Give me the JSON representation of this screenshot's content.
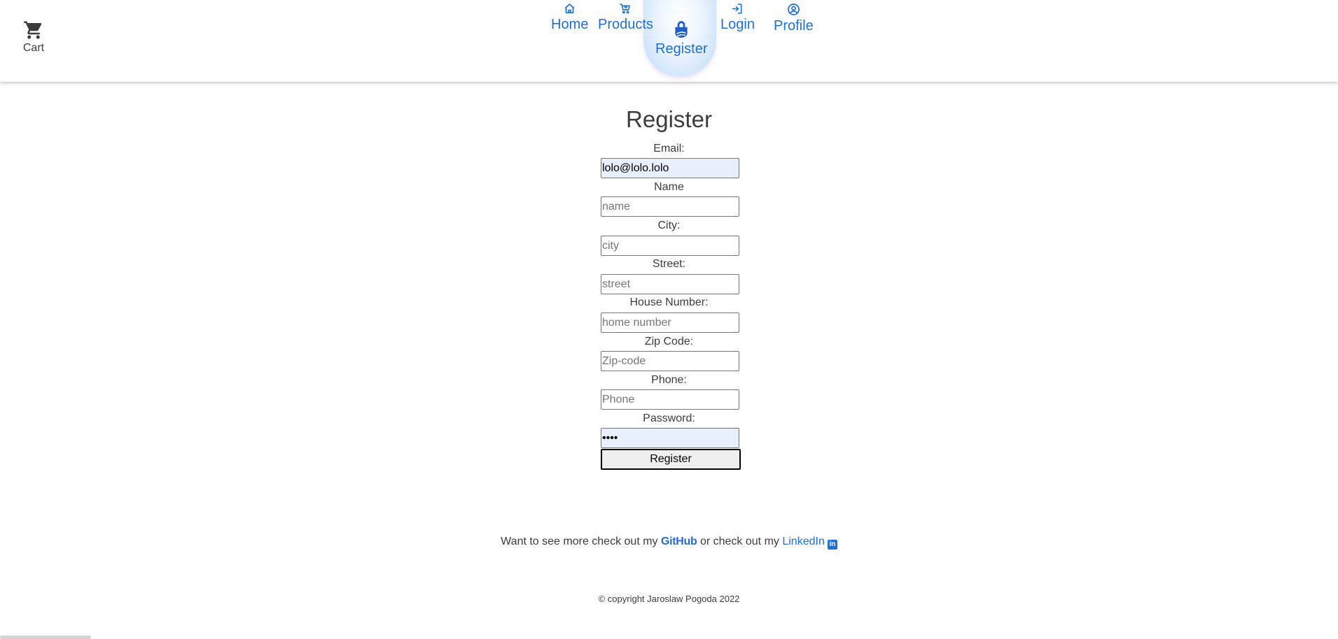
{
  "header": {
    "cart_label": "Cart",
    "nav": [
      {
        "label": "Home",
        "icon": "home-icon"
      },
      {
        "label": "Products",
        "icon": "cart-icon"
      },
      {
        "label": "Register",
        "icon": "lock-icon",
        "active": true
      },
      {
        "label": "Login",
        "icon": "login-icon"
      },
      {
        "label": "Profile",
        "icon": "user-circle-icon"
      }
    ]
  },
  "form": {
    "title": "Register",
    "fields": [
      {
        "label": "Email:",
        "value": "lolo@lolo.lolo",
        "placeholder": ""
      },
      {
        "label": "Name",
        "value": "",
        "placeholder": "name"
      },
      {
        "label": "City:",
        "value": "",
        "placeholder": "city"
      },
      {
        "label": "Street:",
        "value": "",
        "placeholder": "street"
      },
      {
        "label": "House Number:",
        "value": "",
        "placeholder": "home number"
      },
      {
        "label": "Zip Code:",
        "value": "",
        "placeholder": "Zip-code"
      },
      {
        "label": "Phone:",
        "value": "",
        "placeholder": "Phone"
      },
      {
        "label": "Password:",
        "value": "••••",
        "placeholder": ""
      }
    ],
    "submit_label": "Register"
  },
  "footer": {
    "text_before": "Want to see more check out my ",
    "github_label": "GitHub",
    "text_middle": " or check out my ",
    "linkedin_label": "LinkedIn",
    "linkedin_badge": "in",
    "copyright": "© copyright Jaroslaw Pogoda 2022"
  },
  "colors": {
    "accent": "#1f6fd6",
    "text": "#3c3c3c",
    "autofill": "#e8f0fe"
  }
}
